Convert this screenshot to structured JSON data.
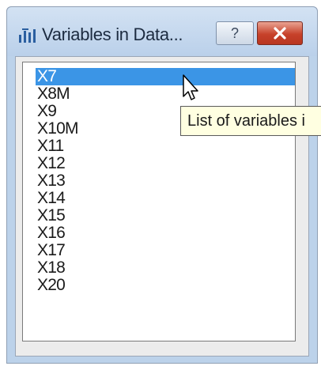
{
  "window": {
    "title": "Variables in Data...",
    "help_label": "?"
  },
  "variables": [
    "X7",
    "X8M",
    "X9",
    "X10M",
    "X11",
    "X12",
    "X13",
    "X14",
    "X15",
    "X16",
    "X17",
    "X18",
    "X20"
  ],
  "selected_variable": "X7",
  "tooltip": {
    "text": "List of variables i"
  },
  "colors": {
    "selection": "#3b95e6",
    "close_button": "#c7412a",
    "tooltip_bg": "#ffffe1"
  }
}
